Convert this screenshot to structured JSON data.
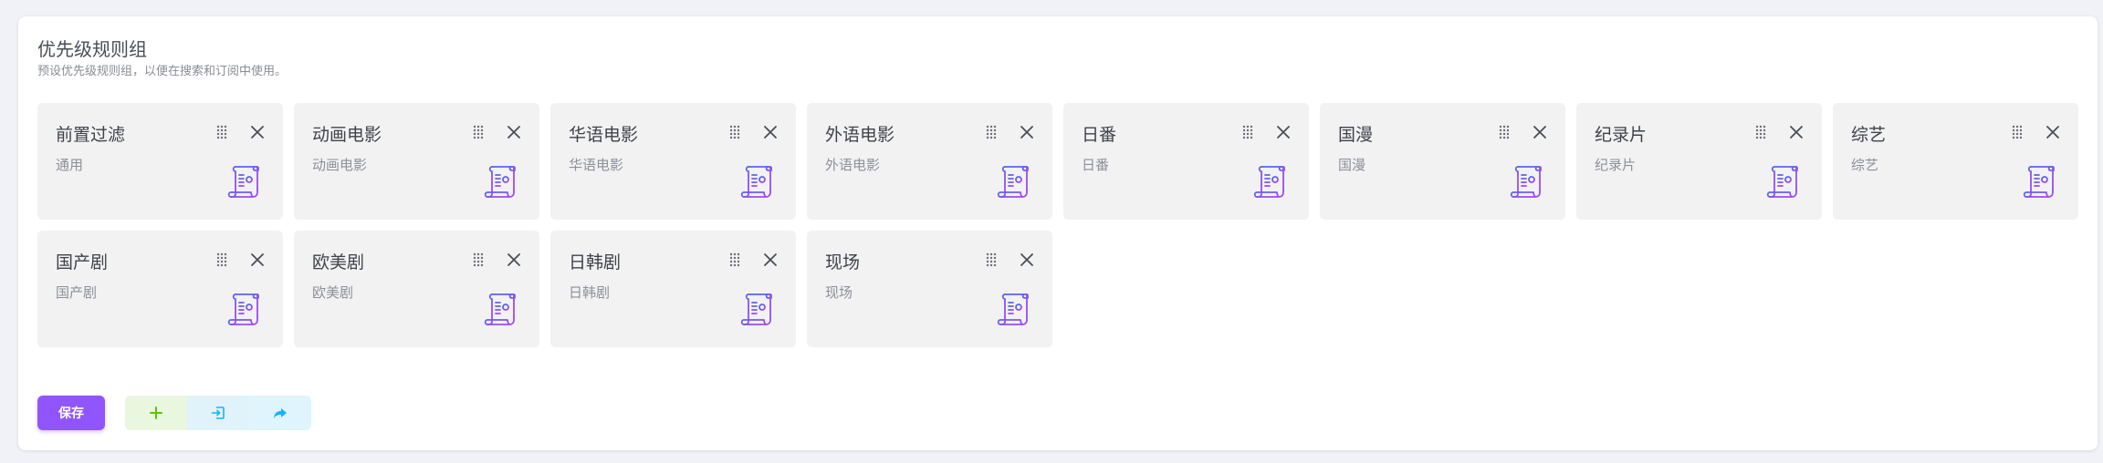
{
  "header": {
    "title": "优先级规则组",
    "subtitle": "预设优先级规则组，以便在搜索和订阅中使用。"
  },
  "rule_groups": [
    {
      "name": "前置过滤",
      "desc": "通用"
    },
    {
      "name": "动画电影",
      "desc": "动画电影"
    },
    {
      "name": "华语电影",
      "desc": "华语电影"
    },
    {
      "name": "外语电影",
      "desc": "外语电影"
    },
    {
      "name": "日番",
      "desc": "日番"
    },
    {
      "name": "国漫",
      "desc": "国漫"
    },
    {
      "name": "纪录片",
      "desc": "纪录片"
    },
    {
      "name": "综艺",
      "desc": "综艺"
    },
    {
      "name": "国产剧",
      "desc": "国产剧"
    },
    {
      "name": "欧美剧",
      "desc": "欧美剧"
    },
    {
      "name": "日韩剧",
      "desc": "日韩剧"
    },
    {
      "name": "现场",
      "desc": "现场"
    }
  ],
  "actions": {
    "save_label": "保存",
    "add_icon": "plus-icon",
    "import_icon": "import-icon",
    "share_icon": "share-icon"
  },
  "colors": {
    "primary": "#9155fd",
    "add_icon": "#56ca00",
    "import_icon": "#16b1ff",
    "doc_icon_gradient_start": "#9155fd",
    "doc_icon_gradient_end": "#3d6ef5"
  }
}
